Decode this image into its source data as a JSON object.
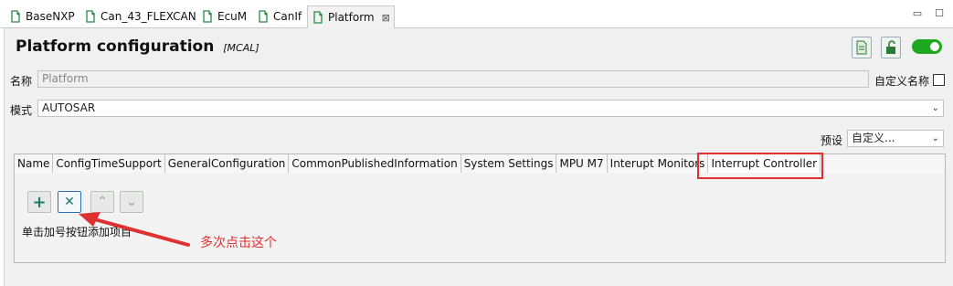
{
  "tabs": [
    {
      "label": "BaseNXP",
      "icon": "plugin-icon"
    },
    {
      "label": "Can_43_FLEXCAN",
      "icon": "plugin-icon"
    },
    {
      "label": "EcuM",
      "icon": "plugin-icon"
    },
    {
      "label": "CanIf",
      "icon": "plugin-icon"
    },
    {
      "label": "Platform",
      "icon": "plugin-icon",
      "active": true,
      "close": "⊠"
    }
  ],
  "window_buttons": {
    "minimize": "▭",
    "maximize": "☐"
  },
  "header": {
    "title": "Platform configuration",
    "subtitle": "[MCAL]"
  },
  "form": {
    "name_label": "名称",
    "name_value": "Platform",
    "custom_name_label": "自定义名称",
    "mode_label": "模式",
    "mode_value": "AUTOSAR",
    "preset_label": "预设",
    "preset_value": "自定义..."
  },
  "config_tabs": [
    "Name",
    "ConfigTimeSupport",
    "GeneralConfiguration",
    "CommonPublishedInformation",
    "System Settings",
    "MPU M7",
    "Interupt Monitors",
    "Interrupt Controller"
  ],
  "actions": {
    "add": "+",
    "remove": "✕",
    "up": "⌃",
    "down": "⌄"
  },
  "hint_text": "单击加号按钮添加项目",
  "annotation_text": "多次点击这个",
  "colors": {
    "toggle": "#21a821",
    "annotation": "#e03030",
    "accent_teal": "#1f7a6a"
  }
}
